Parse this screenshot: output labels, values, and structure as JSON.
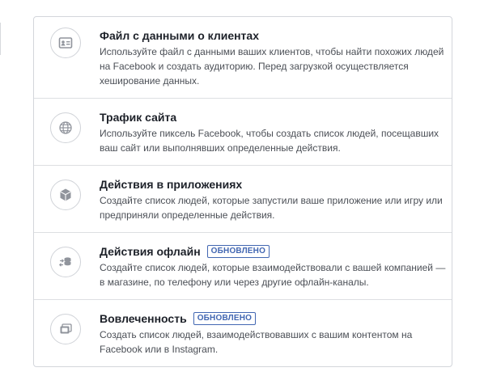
{
  "options": [
    {
      "icon": "contact-card-icon",
      "title": "Файл с данными о клиентах",
      "badge": "",
      "description": "Используйте файл с данными ваших клиентов, чтобы найти похожих людей на Facebook и создать аудиторию. Перед загрузкой осуществляется хеширование данных."
    },
    {
      "icon": "globe-icon",
      "title": "Трафик сайта",
      "badge": "",
      "description": "Используйте пиксель Facebook, чтобы создать список людей, посещавших ваш сайт или выполнявших определенные действия."
    },
    {
      "icon": "cube-icon",
      "title": "Действия в приложениях",
      "badge": "",
      "description": "Создайте список людей, которые запустили ваше приложение или игру или предприняли определенные действия."
    },
    {
      "icon": "offline-sync-icon",
      "title": "Действия офлайн",
      "badge": "ОБНОВЛЕНО",
      "description": "Создайте список людей, которые взаимодействовали с вашей компанией — в магазине, по телефону или через другие офлайн-каналы."
    },
    {
      "icon": "engagement-icon",
      "title": "Вовлеченность",
      "badge": "ОБНОВЛЕНО",
      "description": "Создать список людей, взаимодействовавших с вашим контентом на Facebook или в Instagram."
    }
  ],
  "colors": {
    "title": "#1d2129",
    "description": "#4b4f56",
    "badge": "#4267b2",
    "border": "#d3d6db",
    "icon": "#90949c"
  }
}
